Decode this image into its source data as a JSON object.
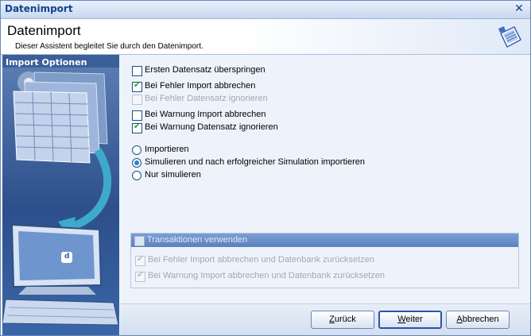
{
  "window": {
    "title": "Datenimport"
  },
  "header": {
    "title": "Datenimport",
    "subtitle": "Dieser Assistent begleitet Sie durch den Datenimport."
  },
  "left_panel": {
    "title": "Import Optionen",
    "illustration_badge": "d"
  },
  "options": {
    "skip_first": {
      "label": "Ersten Datensatz überspringen",
      "checked": false
    },
    "error_abort": {
      "label": "Bei Fehler Import abbrechen",
      "checked": true
    },
    "error_ignore": {
      "label": "Bei Fehler Datensatz ignorieren",
      "checked": false,
      "disabled": true
    },
    "warn_abort": {
      "label": "Bei Warnung Import abbrechen",
      "checked": false
    },
    "warn_ignore": {
      "label": "Bei Warnung Datensatz ignorieren",
      "checked": true
    }
  },
  "modes": [
    {
      "label": "Importieren",
      "selected": false
    },
    {
      "label": "Simulieren und nach erfolgreicher Simulation importieren",
      "selected": true
    },
    {
      "label": "Nur simulieren",
      "selected": false
    }
  ],
  "transactions": {
    "header_label": "Transaktionen verwenden",
    "error_rollback": "Bei Fehler Import abbrechen und Datenbank zurücksetzen",
    "warn_rollback": "Bei Warnung Import abbrechen und Datenbank zurücksetzen"
  },
  "buttons": {
    "back": {
      "first": "Z",
      "rest": "urück"
    },
    "next": {
      "first": "W",
      "rest": "eiter"
    },
    "cancel": {
      "first": "A",
      "rest": "bbrechen"
    }
  },
  "icons": {
    "close": "close-icon",
    "wizard": "wizard-icon"
  }
}
